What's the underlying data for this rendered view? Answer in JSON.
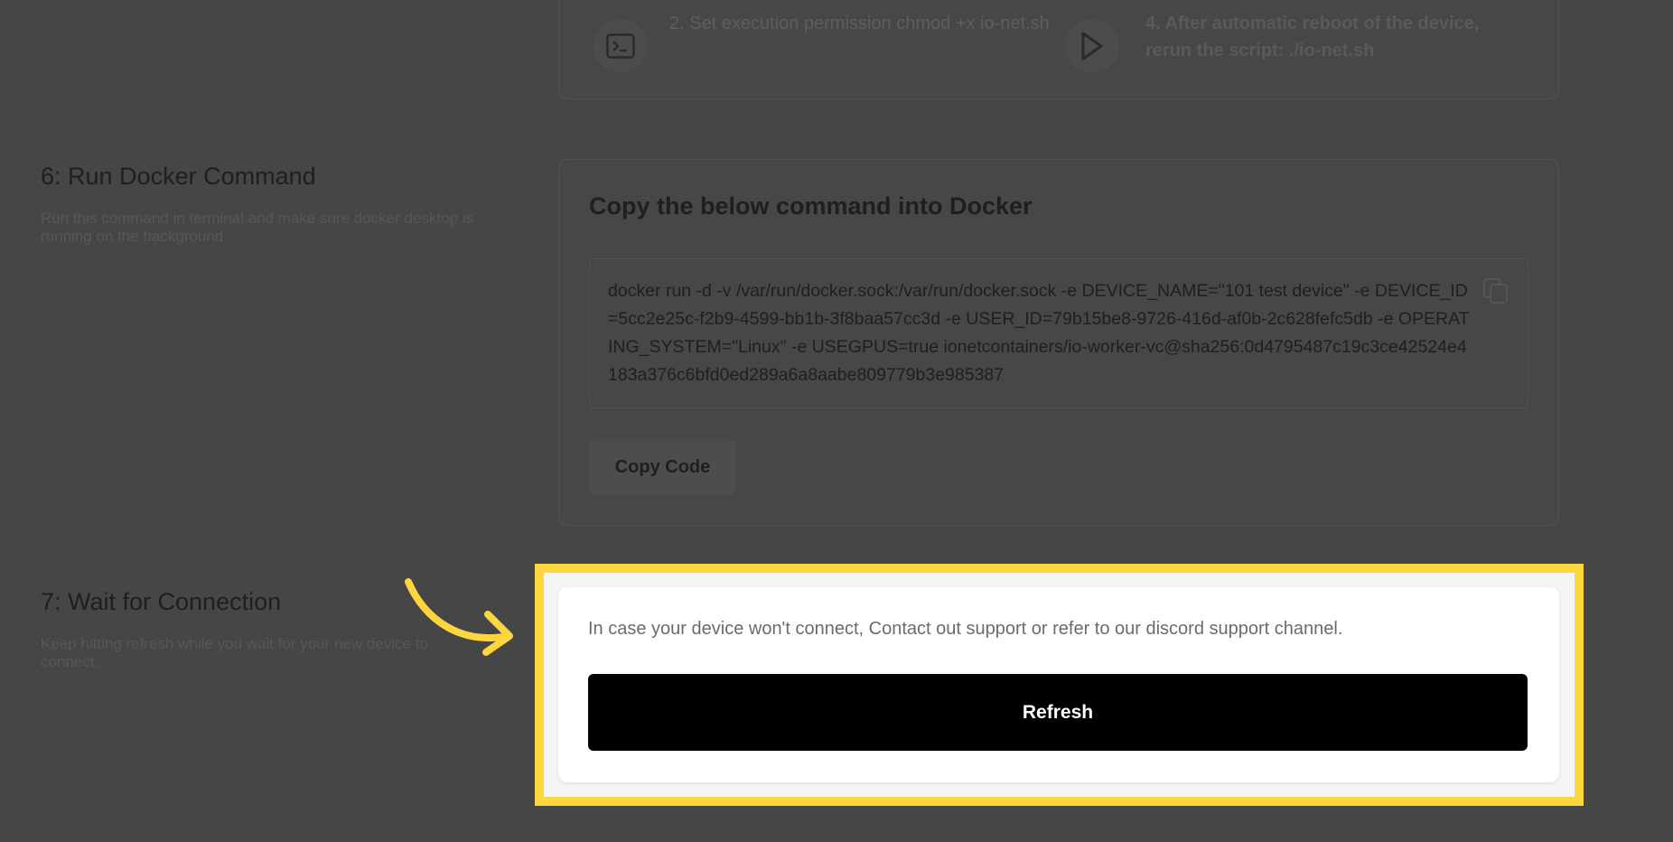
{
  "step5": {
    "item2_text": "2. Set execution permission chmod +x io-net.sh",
    "item2_icon": "terminal-icon",
    "item4_text": "4. After automatic reboot of the device, rerun the script: ./io-net.sh",
    "item4_icon": "play-icon"
  },
  "step6": {
    "title": "6: Run Docker Command",
    "description": "Run this command in terminal and make sure docker desktop is running on the background",
    "card_heading": "Copy the below command into Docker",
    "command": "docker run -d -v /var/run/docker.sock:/var/run/docker.sock -e DEVICE_NAME=\"101 test device\" -e DEVICE_ID=5cc2e25c-f2b9-4599-bb1b-3f8baa57cc3d -e USER_ID=79b15be8-9726-416d-af0b-2c628fefc5db -e OPERATING_SYSTEM=\"Linux\" -e USEGPUS=true ionetcontainers/io-worker-vc@sha256:0d4795487c19c3ce42524e4183a376c6bfd0ed289a6a8aabe809779b3e985387",
    "copy_icon": "copy-icon",
    "copy_button_label": "Copy Code"
  },
  "step7": {
    "title": "7: Wait for Connection",
    "description": "Keep hitting refresh while you wait for your new device to connect.",
    "card_text": "In case your device won't connect, Contact out support or refer to our discord support channel.",
    "refresh_label": "Refresh"
  },
  "colors": {
    "overlay": "#464646",
    "highlight": "#fcd53f",
    "button_bg": "#000000"
  }
}
